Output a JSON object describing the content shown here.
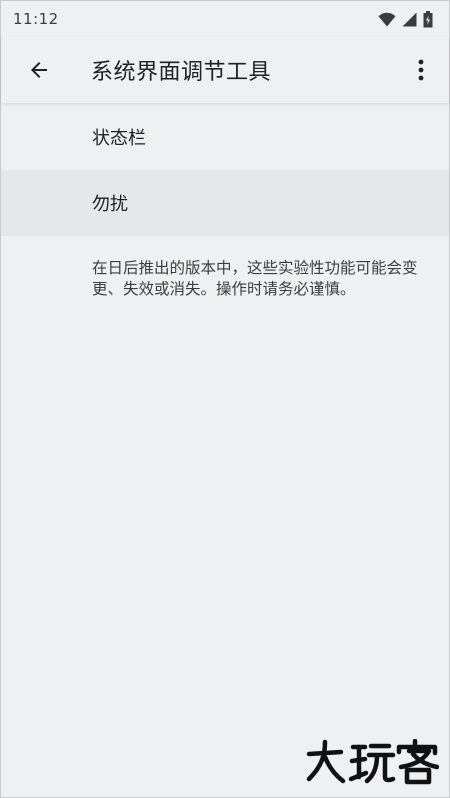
{
  "status_bar": {
    "time": "11:12",
    "icons": [
      "wifi-icon",
      "signal-icon",
      "battery-icon"
    ]
  },
  "app_bar": {
    "back_icon": "arrow-back-icon",
    "title": "系统界面调节工具",
    "overflow_icon": "more-vert-icon"
  },
  "list": {
    "items": [
      {
        "label": "状态栏"
      },
      {
        "label": "勿扰"
      }
    ],
    "footnote": "在日后推出的版本中，这些实验性功能可能会变更、失效或消失。操作时请务必谨慎。"
  },
  "watermark": {
    "text": "大玩客"
  },
  "colors": {
    "background": "#eff0f2",
    "highlight": "#e5e7e8",
    "text_primary": "#202124"
  }
}
